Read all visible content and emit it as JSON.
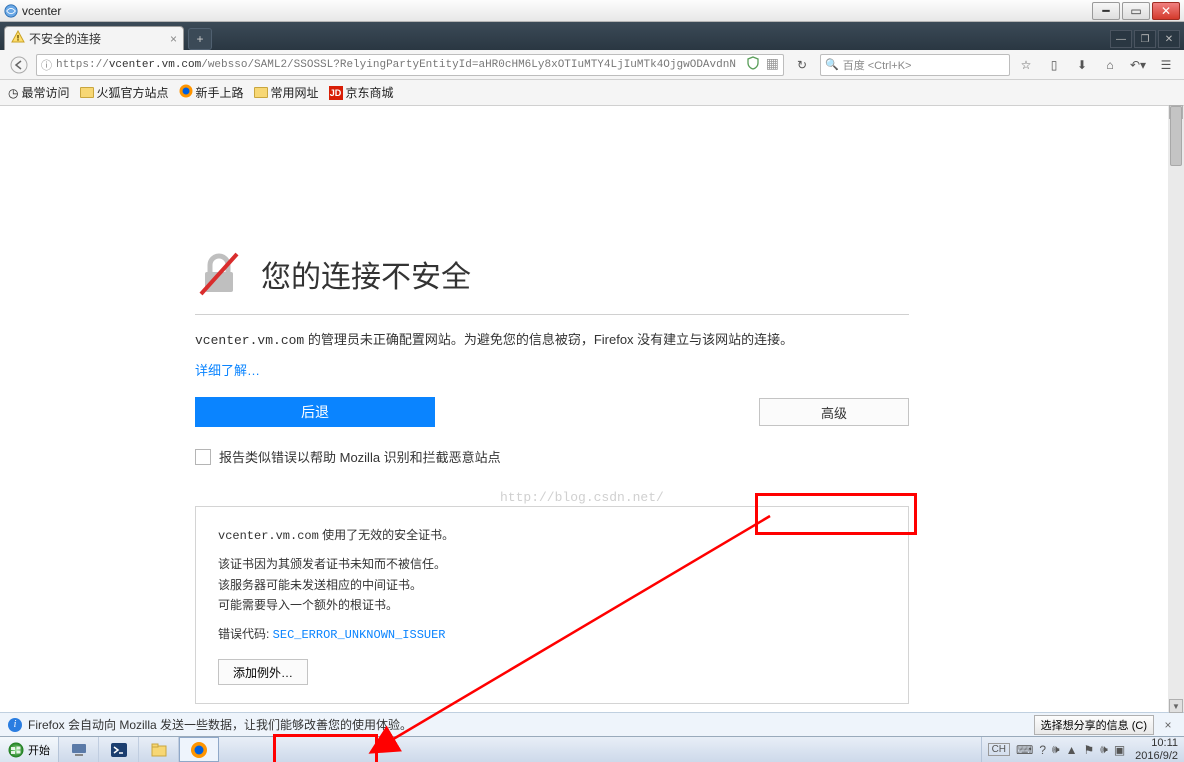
{
  "window": {
    "title": "vcenter"
  },
  "tab": {
    "title": "不安全的连接"
  },
  "nav": {
    "url_prefix": "https://",
    "url_domain": "vcenter.vm.com",
    "url_rest": "/websso/SAML2/SSOSSL?RelyingPartyEntityId=aHR0cHM6Ly8xOTIuMTY4LjIuMTk4OjgwODAvdnN",
    "search_engine": "百度",
    "search_placeholder": "百度 <Ctrl+K>"
  },
  "bookmarks": {
    "most_visited": "最常访问",
    "firefox_official": "火狐官方站点",
    "getting_started": "新手上路",
    "common_urls": "常用网址",
    "jd": "京东商城"
  },
  "error": {
    "heading": "您的连接不安全",
    "domain": "vcenter.vm.com",
    "desc_part1": " 的管理员未正确配置网站。为避免您的信息被窃，Firefox 没有建立与该网站的连接。",
    "learn_more": "详细了解…",
    "back_button": "后退",
    "advanced_button": "高级",
    "report_checkbox": "报告类似错误以帮助 Mozilla 识别和拦截恶意站点"
  },
  "advanced": {
    "line1_domain": "vcenter.vm.com",
    "line1_rest": " 使用了无效的安全证书。",
    "line2": "该证书因为其颁发者证书未知而不被信任。",
    "line3": "该服务器可能未发送相应的中间证书。",
    "line4": "可能需要导入一个额外的根证书。",
    "errcode_label": "错误代码: ",
    "errcode": "SEC_ERROR_UNKNOWN_ISSUER",
    "add_exception": "添加例外…"
  },
  "watermark": "http://blog.csdn.net/",
  "infobar": {
    "text": "Firefox 会自动向 Mozilla 发送一些数据，让我们能够改善您的使用体验。",
    "select": "选择想分享的信息 (C)"
  },
  "taskbar": {
    "start": "开始",
    "ime": "CH",
    "time": "10:11",
    "date": "2016/9/2"
  }
}
